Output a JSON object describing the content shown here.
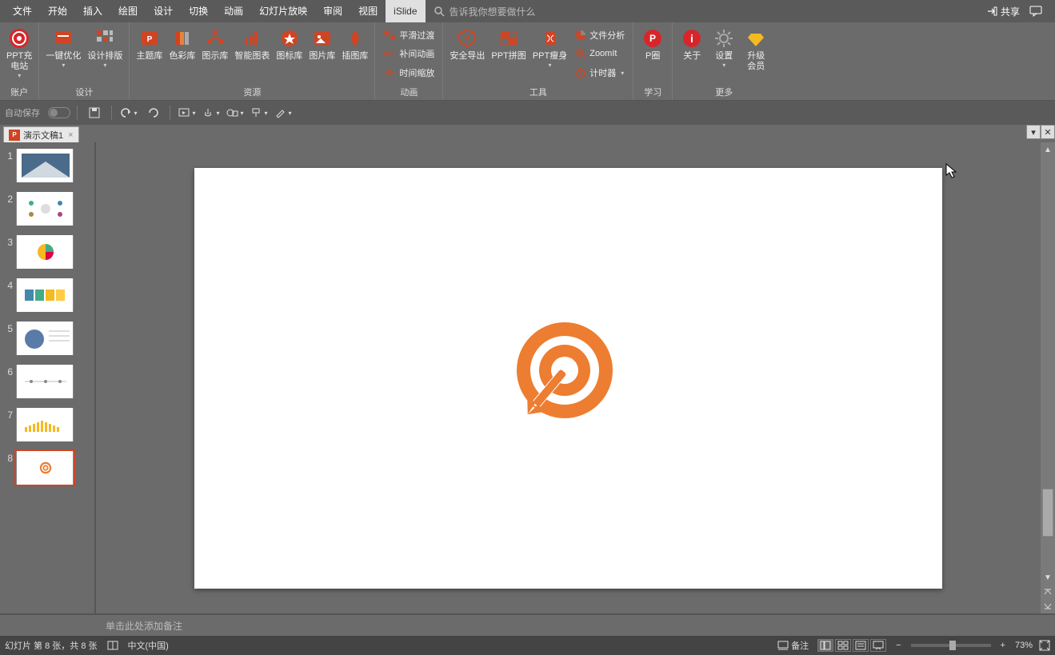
{
  "menubar": {
    "items": [
      "文件",
      "开始",
      "插入",
      "绘图",
      "设计",
      "切换",
      "动画",
      "幻灯片放映",
      "审阅",
      "视图",
      "iSlide"
    ],
    "active_index": 10,
    "search_placeholder": "告诉我你想要做什么",
    "share_label": "共享"
  },
  "ribbon": {
    "group_account": {
      "label": "账户",
      "btn_ppt_station": "PPT充\n电站"
    },
    "group_design": {
      "label": "设计",
      "btn_onekey": "一键优化",
      "btn_layout": "设计排版"
    },
    "group_resource": {
      "label": "资源",
      "btn_theme": "主题库",
      "btn_color": "色彩库",
      "btn_diagram": "图示库",
      "btn_chart": "智能图表",
      "btn_icon": "图标库",
      "btn_image": "图片库",
      "btn_illus": "插图库"
    },
    "group_anim": {
      "label": "动画",
      "row1": "平滑过渡",
      "row2": "补间动画",
      "row3": "时间缩放"
    },
    "group_tools": {
      "label": "工具",
      "btn_export": "安全导出",
      "btn_puzzle": "PPT拼图",
      "btn_slim": "PPT瘦身",
      "row1": "文件分析",
      "row2": "ZoomIt",
      "row3": "计时器"
    },
    "group_learn": {
      "label": "学习",
      "btn_pcircle": "P圈"
    },
    "group_more": {
      "label": "更多",
      "btn_about": "关于",
      "btn_settings": "设置",
      "btn_upgrade": "升级\n会员"
    }
  },
  "qat": {
    "autosave": "自动保存"
  },
  "doctab": {
    "name": "演示文稿1"
  },
  "thumbs": {
    "count": 8,
    "selected": 8
  },
  "notes": {
    "placeholder": "单击此处添加备注"
  },
  "statusbar": {
    "slide_info": "幻灯片 第 8 张，共 8 张",
    "lang": "中文(中国)",
    "notes_btn": "备注",
    "zoom_pct": "73%",
    "zoom_plus": "+",
    "zoom_minus": "−"
  }
}
